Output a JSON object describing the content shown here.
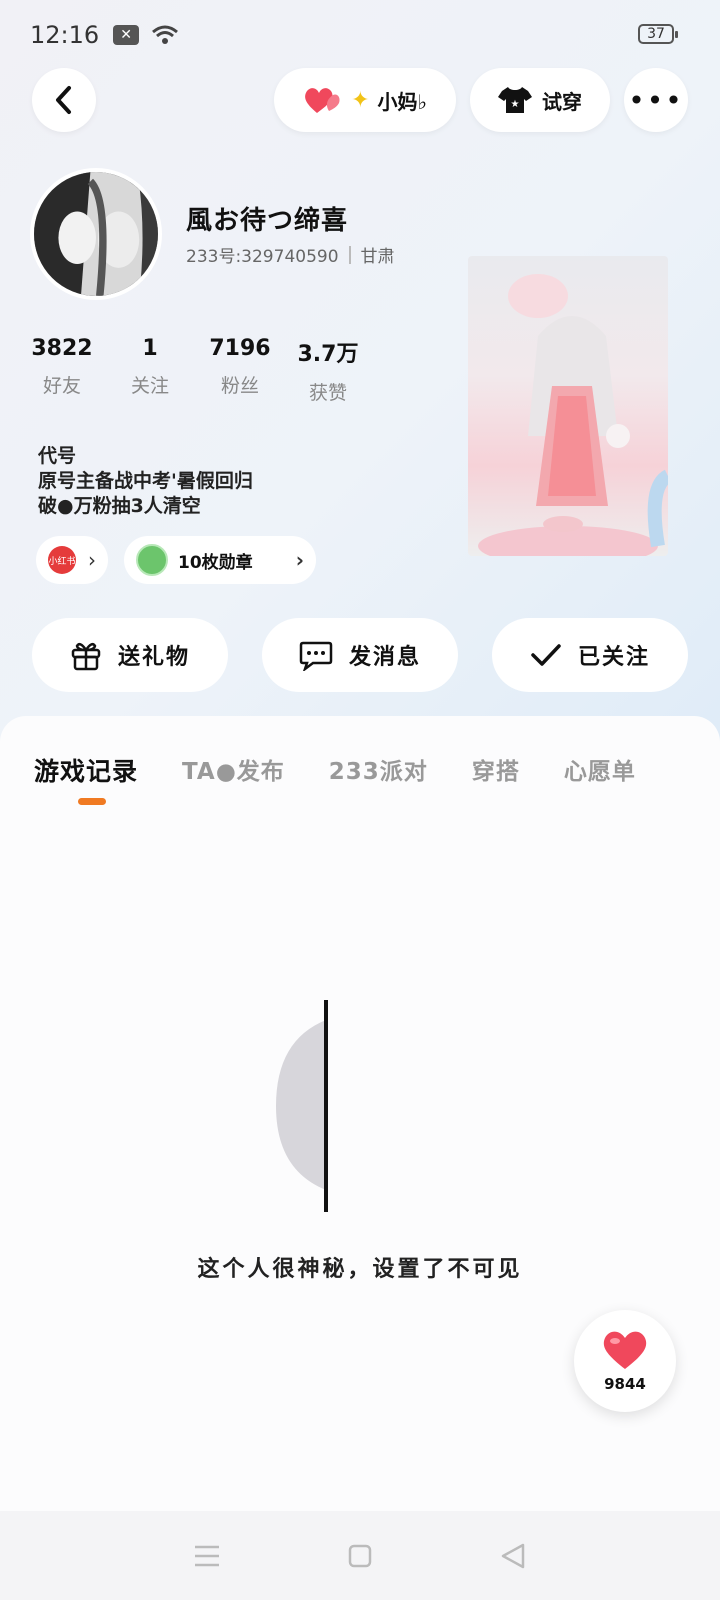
{
  "status_bar": {
    "time": "12:16",
    "battery": "37"
  },
  "header": {
    "tag_label": "小妈♭",
    "tryon_label": "试穿"
  },
  "profile": {
    "username": "風お待つ缔喜",
    "id_text": "233号:329740590",
    "region": "甘肃",
    "stats": [
      {
        "value": "3822",
        "label": "好友"
      },
      {
        "value": "1",
        "label": "关注"
      },
      {
        "value": "7196",
        "label": "粉丝"
      },
      {
        "value": "3.7万",
        "label": "获赞"
      }
    ],
    "bio_lines": [
      "代号",
      "原号主备战中考'暑假回归",
      "破●万粉抽3人清空"
    ],
    "xhs_logo_text": "小红书",
    "badges_label": "10枚勋章"
  },
  "actions": {
    "gift": "送礼物",
    "message": "发消息",
    "followed": "已关注"
  },
  "tabs": [
    "游戏记录",
    "TA●发布",
    "233派对",
    "穿搭",
    "心愿单"
  ],
  "empty_state": {
    "text": "这个人很神秘，设置了不可见"
  },
  "like_fab": {
    "count": "9844"
  },
  "colors": {
    "accent": "#f07a22",
    "heart": "#f0485c"
  }
}
